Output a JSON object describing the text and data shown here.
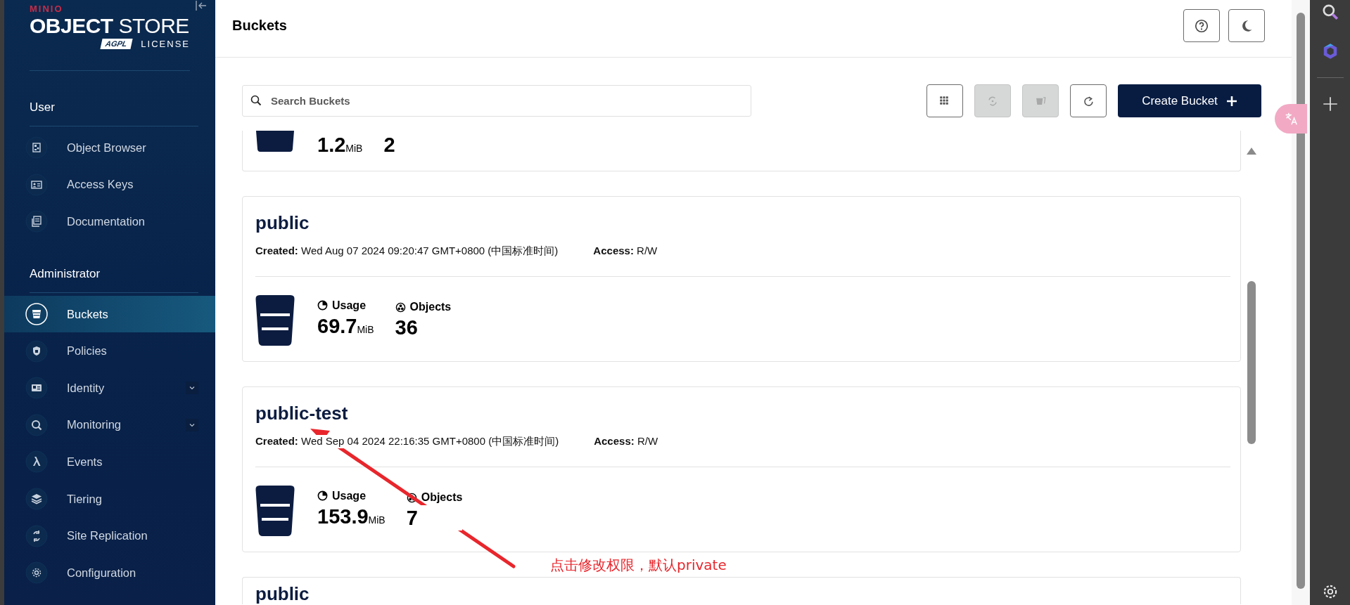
{
  "sidebar": {
    "logo": {
      "brand": "MINIO",
      "product_bold": "OBJECT",
      "product_light": "STORE",
      "badge": "AGPL",
      "license": "LICENSE"
    },
    "sections": [
      {
        "title": "User",
        "items": [
          {
            "label": "Object Browser",
            "kind": "link",
            "selected": false
          },
          {
            "label": "Access Keys",
            "kind": "link",
            "selected": false
          },
          {
            "label": "Documentation",
            "kind": "link",
            "selected": false
          }
        ]
      },
      {
        "title": "Administrator",
        "items": [
          {
            "label": "Buckets",
            "kind": "link",
            "selected": true
          },
          {
            "label": "Policies",
            "kind": "link",
            "selected": false
          },
          {
            "label": "Identity",
            "kind": "group",
            "selected": false,
            "expanded": false
          },
          {
            "label": "Monitoring",
            "kind": "group",
            "selected": false,
            "expanded": false
          },
          {
            "label": "Events",
            "kind": "link",
            "selected": false
          },
          {
            "label": "Tiering",
            "kind": "link",
            "selected": false
          },
          {
            "label": "Site Replication",
            "kind": "link",
            "selected": false
          },
          {
            "label": "Configuration",
            "kind": "link",
            "selected": false
          }
        ]
      }
    ]
  },
  "header": {
    "title": "Buckets"
  },
  "toolbar": {
    "search": {
      "placeholder": "Search Buckets"
    },
    "icon_buttons": [
      {
        "disabled": false
      },
      {
        "disabled": true
      },
      {
        "disabled": true
      },
      {
        "disabled": false
      }
    ],
    "create_button": "Create Bucket"
  },
  "buckets": [
    {
      "kind": "stats_only",
      "usage": "1.2",
      "usage_unit": "MiB",
      "objects": "2"
    },
    {
      "kind": "full",
      "name": "public",
      "created_label": "Created:",
      "created": "Wed Aug 07 2024 09:20:47 GMT+0800 (中国标准时间)",
      "access_label": "Access:",
      "access": "R/W",
      "usage_label": "Usage",
      "usage": "69.7",
      "usage_unit": "MiB",
      "objects_label": "Objects",
      "objects": "36"
    },
    {
      "kind": "full",
      "name": "public-test",
      "created_label": "Created:",
      "created": "Wed Sep 04 2024 22:16:35 GMT+0800 (中国标准时间)",
      "access_label": "Access:",
      "access": "R/W",
      "usage_label": "Usage",
      "usage": "153.9",
      "usage_unit": "MiB",
      "objects_label": "Objects",
      "objects": "7"
    },
    {
      "kind": "title_only",
      "name": "public"
    }
  ],
  "annotation": {
    "text": "点击修改权限，默认private"
  }
}
